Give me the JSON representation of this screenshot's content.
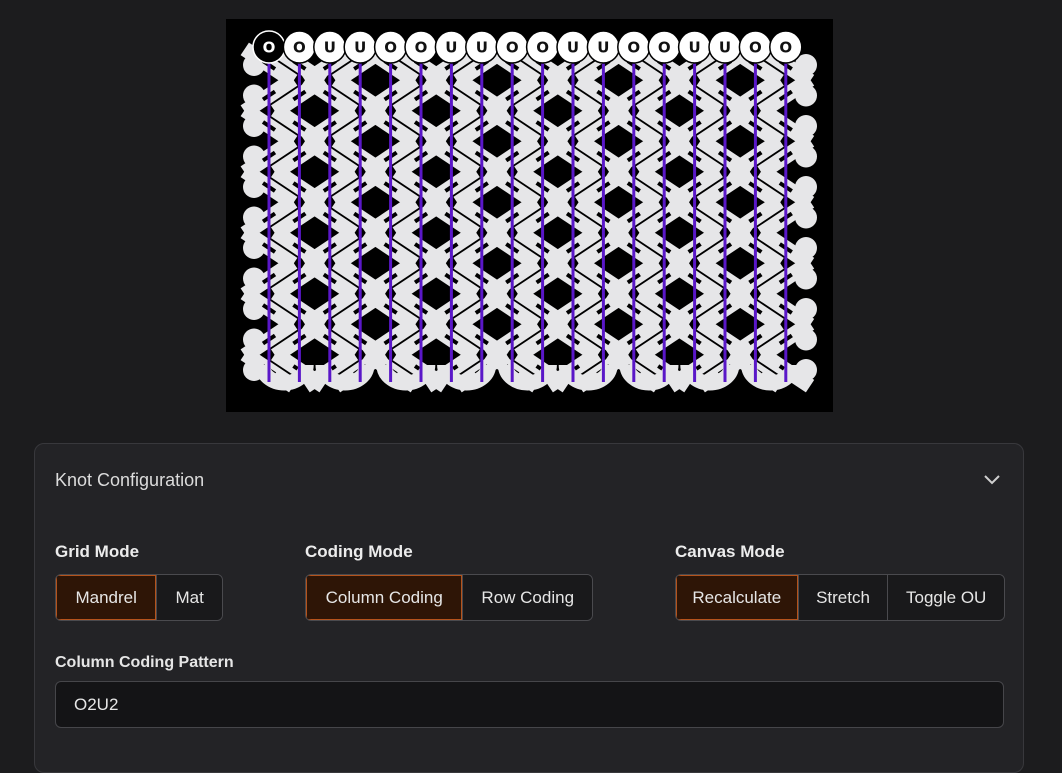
{
  "knot_preview": {
    "column_codes": [
      "O",
      "O",
      "U",
      "U",
      "O",
      "O",
      "U",
      "U",
      "O",
      "O",
      "U",
      "U",
      "O",
      "O",
      "U",
      "U",
      "O",
      "O"
    ],
    "selected_index": 0,
    "colors": {
      "background": "#000000",
      "strand": "#e6e6e8",
      "bight": "#5a17c8",
      "bead": "#ffffff",
      "bead_selected": "#000000"
    }
  },
  "panel": {
    "title": "Knot Configuration",
    "grid_mode": {
      "label": "Grid Mode",
      "options": [
        "Mandrel",
        "Mat"
      ],
      "selected": "Mandrel"
    },
    "coding_mode": {
      "label": "Coding Mode",
      "options": [
        "Column Coding",
        "Row Coding"
      ],
      "selected": "Column Coding"
    },
    "canvas_mode": {
      "label": "Canvas Mode",
      "options": [
        "Recalculate",
        "Stretch",
        "Toggle OU"
      ],
      "selected": "Recalculate"
    },
    "pattern": {
      "label": "Column Coding Pattern",
      "value": "O2U2"
    }
  },
  "colors": {
    "accent_border": "#b5531c",
    "accent_fill": "#2e1506",
    "page_bg": "#1c1c1e"
  }
}
